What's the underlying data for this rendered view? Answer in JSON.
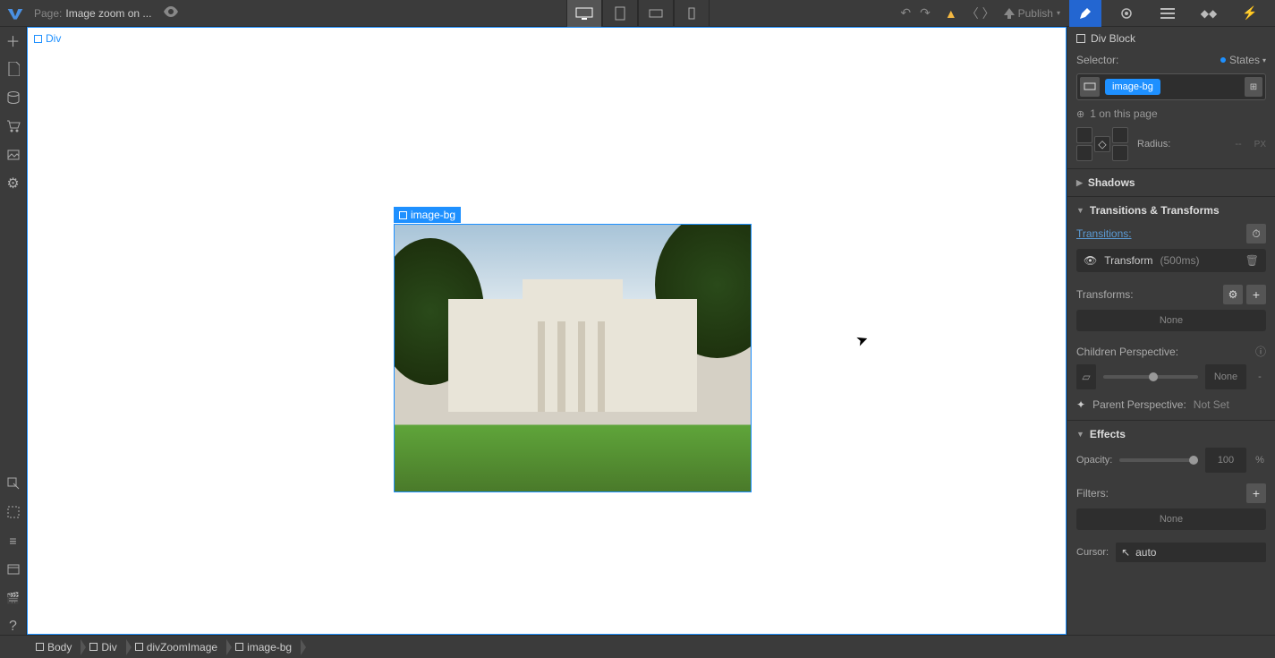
{
  "topbar": {
    "page_label": "Page:",
    "page_name": "Image zoom on ...",
    "publish_label": "Publish"
  },
  "canvas": {
    "outer_badge": "Div",
    "selected_badge": "image-bg"
  },
  "rightpanel": {
    "element_type": "Div Block",
    "selector_label": "Selector:",
    "states_label": "States",
    "class_tag": "image-bg",
    "count_text": "1 on this page",
    "radius": {
      "label": "Radius:",
      "value": "--",
      "unit": "PX"
    },
    "sections": {
      "shadows": "Shadows",
      "transitions": "Transitions & Transforms",
      "effects": "Effects"
    },
    "transitions": {
      "label": "Transitions:",
      "item_name": "Transform",
      "item_duration": "(500ms)",
      "transforms_label": "Transforms:",
      "transforms_none": "None",
      "children_label": "Children Perspective:",
      "children_value": "None",
      "children_unit": "-",
      "parent_label": "Parent Perspective:",
      "parent_value": "Not Set"
    },
    "effects": {
      "opacity_label": "Opacity:",
      "opacity_value": "100",
      "opacity_unit": "%",
      "filters_label": "Filters:",
      "filters_none": "None",
      "cursor_label": "Cursor:",
      "cursor_value": "auto"
    }
  },
  "breadcrumb": [
    "Body",
    "Div",
    "divZoomImage",
    "image-bg"
  ]
}
